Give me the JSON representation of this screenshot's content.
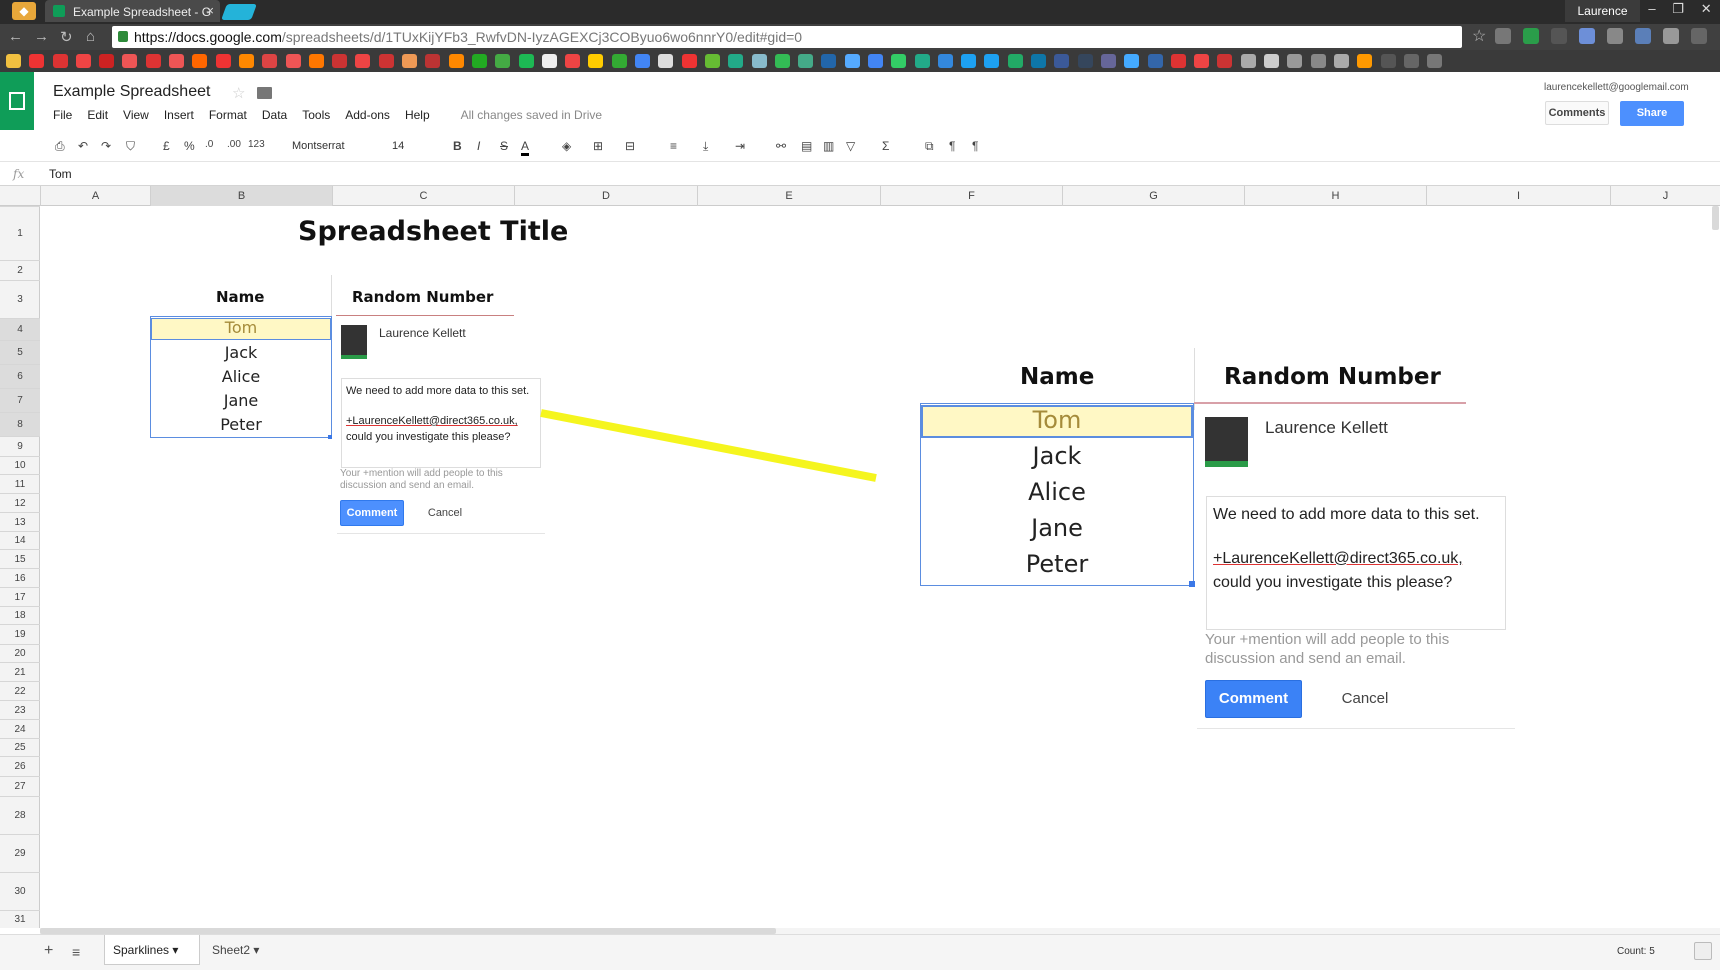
{
  "browser": {
    "tab_title": "Example Spreadsheet - G",
    "profile_name": "Laurence",
    "url_host": "https://docs.google.com",
    "url_path": "/spreadsheets/d/1TUxKijYFb3_RwfvDN-IyzAGEXCj3COByuo6wo6nnrY0/edit#gid=0"
  },
  "sheets": {
    "doc_title": "Example Spreadsheet",
    "menu": [
      "File",
      "Edit",
      "View",
      "Insert",
      "Format",
      "Data",
      "Tools",
      "Add-ons",
      "Help"
    ],
    "save_status": "All changes saved in Drive",
    "user_email": "laurencekellett@googlemail.com",
    "comments_label": "Comments",
    "share_label": "Share",
    "toolbar": {
      "currency": "£",
      "percent": "%",
      "dec_less": ".0",
      "dec_more": ".00",
      "number_format": "123",
      "font": "Montserrat",
      "font_size": "14",
      "bold": "B",
      "italic": "I",
      "strike": "S",
      "text_color": "A",
      "sigma": "Σ"
    },
    "formula_value": "Tom",
    "columns": [
      "A",
      "B",
      "C",
      "D",
      "E",
      "F",
      "G",
      "H",
      "I",
      "J"
    ],
    "rows": [
      "1",
      "2",
      "3",
      "4",
      "5",
      "6",
      "7",
      "8",
      "9",
      "10",
      "11",
      "12",
      "13",
      "14",
      "15",
      "16",
      "17",
      "18",
      "19",
      "20",
      "21",
      "22",
      "23",
      "24",
      "25",
      "26",
      "27",
      "28",
      "29",
      "30",
      "31"
    ]
  },
  "content": {
    "title": "Spreadsheet Title",
    "name_header": "Name",
    "number_header": "Random Number",
    "names": [
      "Tom",
      "Jack",
      "Alice",
      "Jane",
      "Peter"
    ]
  },
  "comment": {
    "author": "Laurence Kellett",
    "line1": "We need to add more data to this set.",
    "mention": "+LaurenceKellett@direct365.co.uk,",
    "line2": "could you investigate this please?",
    "help": "Your +mention will add people to this discussion and send an email.",
    "comment_label": "Comment",
    "cancel_label": "Cancel"
  },
  "footer": {
    "sheet1": "Sparklines",
    "sheet2": "Sheet2",
    "count": "Count: 5"
  },
  "colors": {
    "sheets_green": "#0f9d58",
    "share_blue": "#4d90fe",
    "highlight_yellow": "#fff8c5",
    "connector_yellow": "#f5f51e"
  },
  "icons": [
    "lock-icon",
    "star-icon",
    "folder-icon",
    "print-icon",
    "undo-icon",
    "redo-icon",
    "paint-format-icon",
    "fill-color-icon",
    "borders-icon",
    "merge-icon",
    "align-icon",
    "link-icon",
    "comment-icon",
    "chart-icon",
    "filter-icon",
    "fx-icon",
    "add-sheet-icon",
    "sheet-list-icon"
  ]
}
